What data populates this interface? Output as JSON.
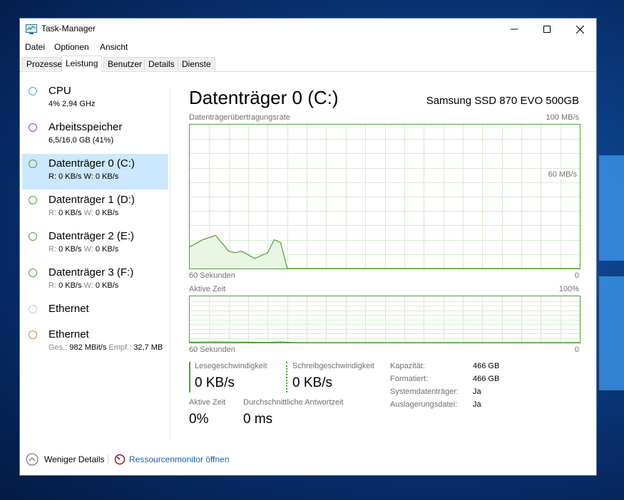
{
  "window": {
    "title": "Task-Manager",
    "icon": "task-manager-icon",
    "controls": [
      "minimize-icon",
      "maximize-icon",
      "close-icon"
    ]
  },
  "menu": [
    "Datei",
    "Optionen",
    "Ansicht"
  ],
  "tabs": [
    {
      "label": "Prozesse",
      "active": false
    },
    {
      "label": "Leistung",
      "active": true
    },
    {
      "label": "Benutzer",
      "active": false
    },
    {
      "label": "Details",
      "active": false
    },
    {
      "label": "Dienste",
      "active": false
    }
  ],
  "sidebar": {
    "items": [
      {
        "title": "CPU",
        "sub": "4% 2,94 GHz",
        "color": "#4fa3d8"
      },
      {
        "title": "Arbeitsspeicher",
        "sub": "6,5/16,0 GB (41%)",
        "color": "#9a36b5"
      },
      {
        "title": "Datenträger 0 (C:)",
        "sub_r_label": "R:",
        "sub_r": "0 KB/s",
        "sub_w_label": "W:",
        "sub_w": "0 KB/s",
        "color": "#4da030",
        "selected": true
      },
      {
        "title": "Datenträger 1 (D:)",
        "sub_r_label": "R:",
        "sub_r": "0 KB/s",
        "sub_w_label": "W:",
        "sub_w": "0 KB/s",
        "color": "#4da030"
      },
      {
        "title": "Datenträger 2 (E:)",
        "sub_r_label": "R:",
        "sub_r": "0 KB/s",
        "sub_w_label": "W:",
        "sub_w": "0 KB/s",
        "color": "#4da030"
      },
      {
        "title": "Datenträger 3 (F:)",
        "sub_r_label": "R:",
        "sub_r": "0 KB/s",
        "sub_w_label": "W:",
        "sub_w": "0 KB/s",
        "color": "#4da030"
      },
      {
        "title": "Ethernet",
        "color": "#c8c8c8"
      },
      {
        "title": "Ethernet",
        "sub_r_label": "Ges.:",
        "sub_r": "982 MBit/s",
        "sub_w_label": "Empf.:",
        "sub_w": "32,7 MB",
        "color": "#c9854a"
      }
    ]
  },
  "main": {
    "title": "Datenträger 0 (C:)",
    "model": "Samsung SSD 870 EVO 500GB",
    "graph1": {
      "label": "Datenträgerübertragungsrate",
      "max_label": "100 MB/s",
      "mid_label": "60 MB/s",
      "x_left": "60 Sekunden",
      "x_right": "0"
    },
    "graph2": {
      "label": "Aktive Zeit",
      "max_label": "100%",
      "x_left": "60 Sekunden",
      "x_right": "0"
    },
    "stats": {
      "read_label": "Lesegeschwindigkeit",
      "read_value": "0 KB/s",
      "write_label": "Schreibgeschwindigkeit",
      "write_value": "0 KB/s",
      "active_label": "Aktive Zeit",
      "active_value": "0%",
      "resp_label": "Durchschnittliche Antwortzeit",
      "resp_value": "0 ms"
    },
    "props": [
      {
        "label": "Kapazität:",
        "value": "466 GB"
      },
      {
        "label": "Formatiert:",
        "value": "466 GB"
      },
      {
        "label": "Systemdatenträger:",
        "value": "Ja"
      },
      {
        "label": "Auslagerungsdatei:",
        "value": "Ja"
      }
    ]
  },
  "footer": {
    "less_details": "Weniger Details",
    "resmon": "Ressourcenmonitor öffnen"
  },
  "chart_data": [
    {
      "type": "area",
      "title": "Datenträgerübertragungsrate",
      "x": [
        -60,
        -58,
        -56,
        -54,
        -53,
        -52,
        -50,
        -48,
        -47,
        -46,
        -45,
        -44,
        0
      ],
      "values": [
        15,
        20,
        23,
        12,
        11,
        12,
        7,
        11,
        20,
        18,
        0,
        0,
        0
      ],
      "ylim": [
        0,
        100
      ],
      "ylabel": "MB/s",
      "color": "#4da030"
    },
    {
      "type": "area",
      "title": "Aktive Zeit",
      "x": [
        -60,
        -56,
        -52,
        -48,
        -46,
        -44,
        0
      ],
      "values": [
        1,
        1.5,
        1,
        0.5,
        1.5,
        0,
        0
      ],
      "ylim": [
        0,
        100
      ],
      "ylabel": "%",
      "color": "#4da030"
    }
  ]
}
